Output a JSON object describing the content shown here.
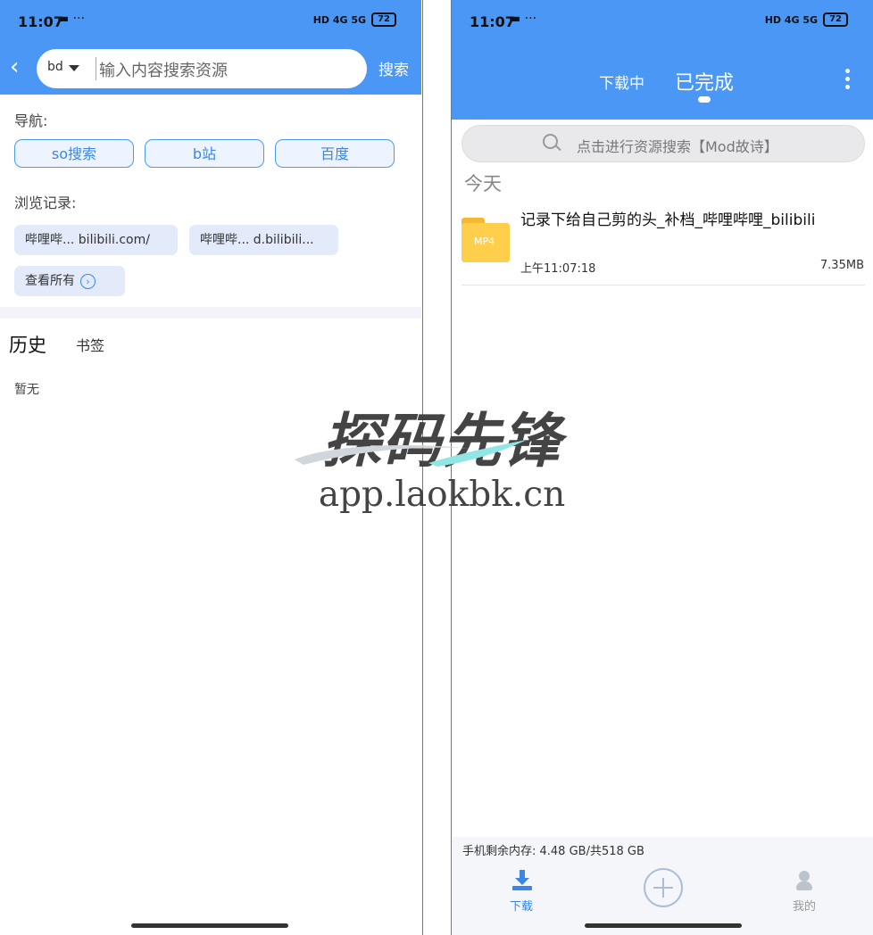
{
  "left_phone": {
    "status": {
      "time": "11:07",
      "icons": "▬ ···",
      "network": "HD 4G 5G",
      "battery": "72"
    },
    "search": {
      "engine": "bd",
      "placeholder": "输入内容搜索资源",
      "button": "搜索"
    },
    "nav_label": "导航:",
    "nav_buttons": [
      "so搜索",
      "b站",
      "百度"
    ],
    "history_label": "浏览记录:",
    "history_chips": [
      "哔哩哔... bilibili.com/",
      "哔哩哔... d.bilibili..."
    ],
    "view_all": "查看所有",
    "tabs": {
      "history": "历史",
      "bookmarks": "书签"
    },
    "empty_text": "暂无"
  },
  "right_phone": {
    "status": {
      "time": "11:07",
      "icons": "▬ ···",
      "network": "HD 4G 5G",
      "battery": "72"
    },
    "tabs": {
      "downloading": "下载中",
      "completed": "已完成"
    },
    "search_placeholder": "点击进行资源搜索【Mod故诗】",
    "section": "今天",
    "file": {
      "type": "MP4",
      "name": "记录下给自己剪的头_补档_哔哩哔哩_bilibili",
      "time": "上午11:07:18",
      "size": "7.35MB"
    },
    "storage": "手机剩余内存: 4.48 GB/共518 GB",
    "bottom_nav": {
      "download": "下载",
      "me": "我的"
    }
  },
  "watermark": {
    "title": "探码先锋",
    "url": "app.laokbk.cn"
  },
  "colors": {
    "accent": "#4b97f5",
    "link": "#3b86e8"
  }
}
